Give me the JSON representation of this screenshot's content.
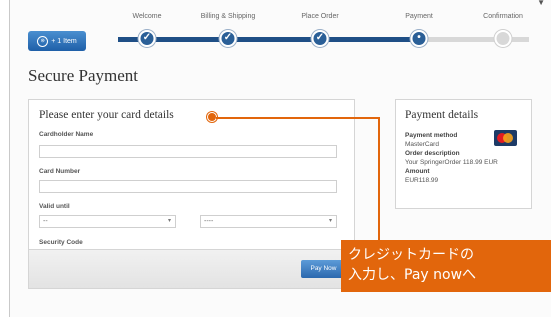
{
  "cart": {
    "label": "+ 1 Item",
    "icon": "cart-icon"
  },
  "steps": [
    {
      "label": "Welcome",
      "status": "done"
    },
    {
      "label": "Billing & Shipping",
      "status": "done"
    },
    {
      "label": "Place Order",
      "status": "done"
    },
    {
      "label": "Payment",
      "status": "current"
    },
    {
      "label": "Confirmation",
      "status": "todo"
    }
  ],
  "page_title": "Secure Payment",
  "card_form": {
    "heading": "Please enter your card details",
    "cardholder_label": "Cardholder Name",
    "cardholder_value": "",
    "card_number_label": "Card Number",
    "card_number_value": "",
    "valid_until_label": "Valid until",
    "month_selected": "--",
    "year_selected": "----",
    "security_code_label": "Security Code",
    "security_code_value": "",
    "pay_button": "Pay Now"
  },
  "details": {
    "title": "Payment details",
    "method_label": "Payment method",
    "method_value": "MasterCard",
    "description_label": "Order description",
    "description_value": "Your SpringerOrder 118.99 EUR",
    "amount_label": "Amount",
    "amount_value": "EUR118.99"
  },
  "callout": {
    "line1": "クレジットカードの",
    "line2": "入力し、Pay nowへ"
  },
  "colors": {
    "accent": "#e2660c",
    "progress": "#1f4f86",
    "button": "#2b68ae"
  }
}
